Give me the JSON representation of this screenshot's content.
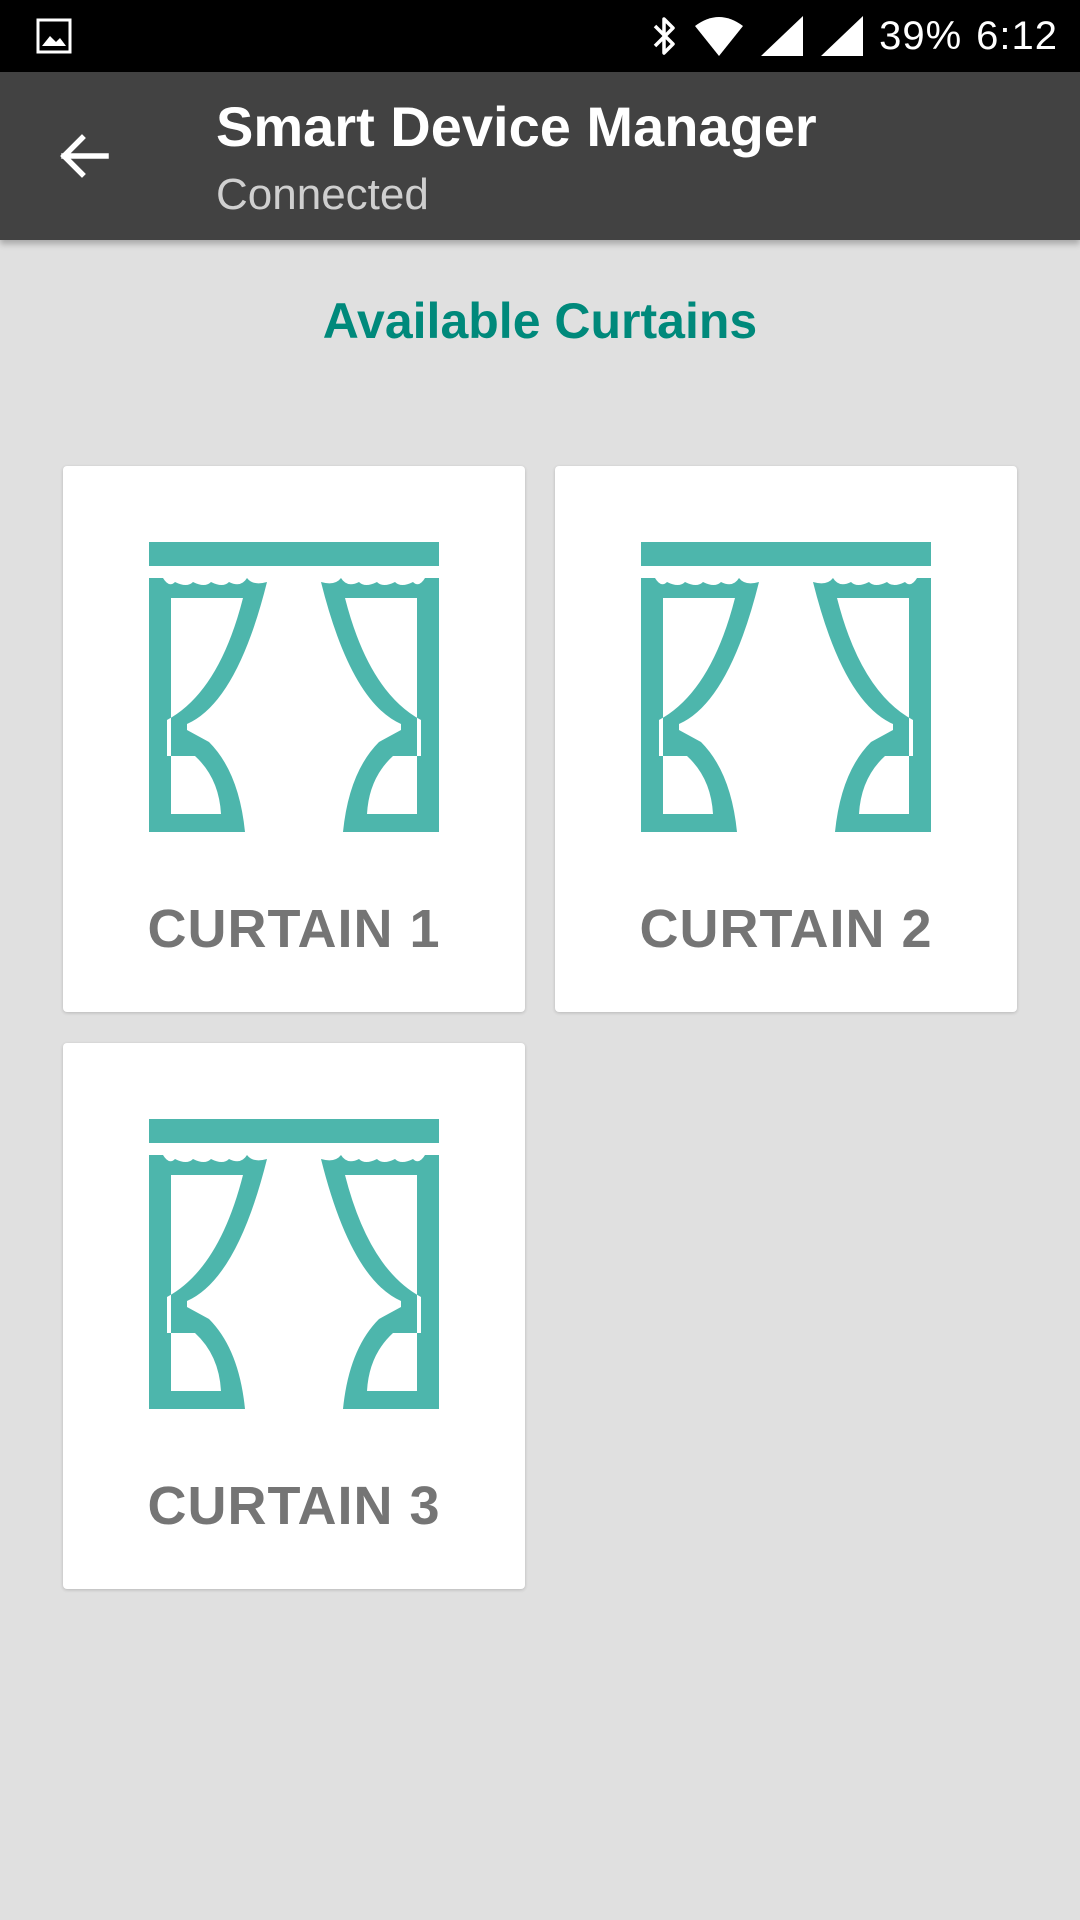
{
  "status_bar": {
    "battery": "39%",
    "time": "6:12",
    "icons": [
      "gallery-icon",
      "bluetooth-icon",
      "wifi-icon",
      "signal-icon",
      "signal-icon"
    ]
  },
  "app_bar": {
    "title": "Smart Device Manager",
    "subtitle": "Connected",
    "back_icon": "arrow-back-icon"
  },
  "main": {
    "heading": "Available Curtains",
    "curtains": [
      {
        "label": "CURTAIN 1",
        "icon": "curtain-icon"
      },
      {
        "label": "CURTAIN 2",
        "icon": "curtain-icon"
      },
      {
        "label": "CURTAIN 3",
        "icon": "curtain-icon"
      }
    ]
  },
  "colors": {
    "status_bar": "#000000",
    "app_bar": "#424242",
    "background": "#e0e0e0",
    "accent": "#00897b",
    "curtain_icon": "#4db6ac",
    "card_label": "#757575"
  }
}
